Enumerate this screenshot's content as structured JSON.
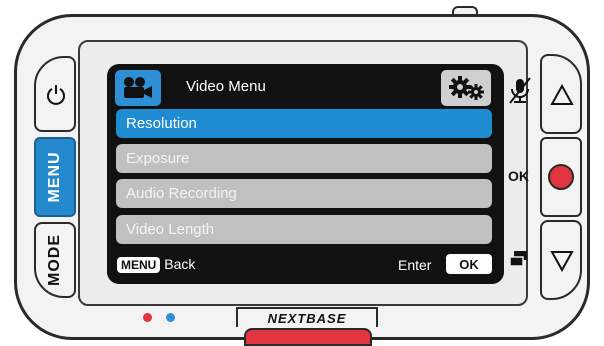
{
  "screen": {
    "title": "Video Menu",
    "title_icon": "video-camera-icon",
    "settings_icon": "gears-icon",
    "menu_items": [
      {
        "label": "Resolution",
        "selected": true
      },
      {
        "label": "Exposure",
        "selected": false
      },
      {
        "label": "Audio Recording",
        "selected": false
      },
      {
        "label": "Video Length",
        "selected": false
      }
    ],
    "footer": {
      "menu_key": "MENU",
      "back_label": "Back",
      "enter_label": "Enter",
      "ok_key": "OK"
    }
  },
  "device": {
    "left_buttons": {
      "menu": "MENU",
      "mode": "MODE"
    },
    "right_buttons": {
      "ok_label": "OK"
    },
    "brand": "NEXTBASE"
  },
  "colors": {
    "accent": "#1f8bd0",
    "record": "#e0343f",
    "led_red": "#e0343f",
    "led_blue": "#2f8fd4"
  }
}
